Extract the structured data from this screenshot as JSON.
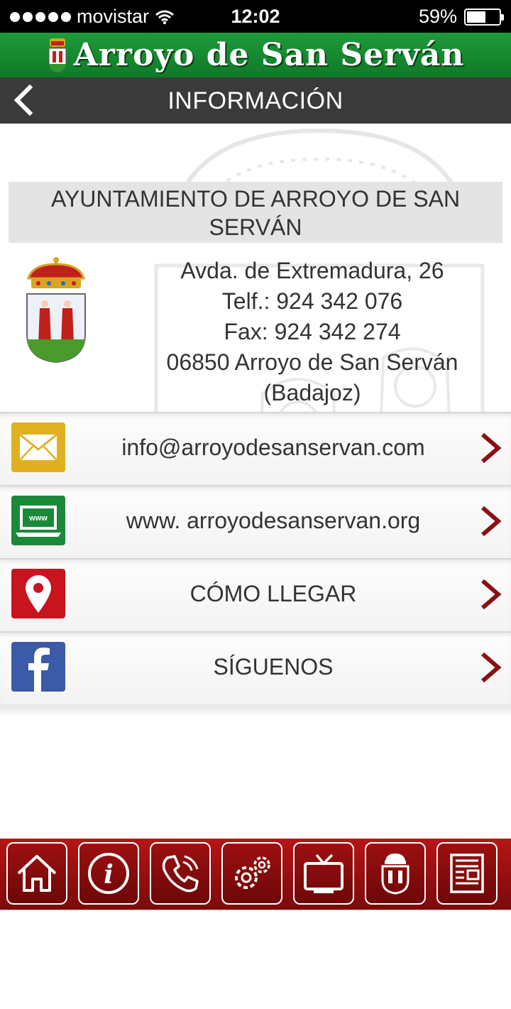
{
  "status_bar": {
    "carrier": "movistar",
    "time": "12:02",
    "battery_text": "59%",
    "battery_level": 0.59
  },
  "brand": {
    "title": "Arroyo de San Serván"
  },
  "navbar": {
    "title": "INFORMACIÓN"
  },
  "info": {
    "heading": "AYUNTAMIENTO DE ARROYO DE SAN SERVÁN",
    "address_lines": [
      "Avda. de Extremadura, 26",
      "Telf.: 924 342 076",
      "Fax: 924 342 274",
      "06850 Arroyo de San Serván",
      "(Badajoz)"
    ]
  },
  "links": [
    {
      "label": "info@arroyodesanservan.com",
      "icon": "mail-icon",
      "color": "#e0b020"
    },
    {
      "label": "www. arroyodesanservan.org",
      "icon": "web-icon",
      "color": "#1a8a3a"
    },
    {
      "label": "CÓMO LLEGAR",
      "icon": "map-pin-icon",
      "color": "#c8141e"
    },
    {
      "label": "SÍGUENOS",
      "icon": "facebook-icon",
      "color": "#3b5ba8"
    }
  ],
  "tabs": [
    {
      "name": "home-icon"
    },
    {
      "name": "info-icon"
    },
    {
      "name": "phone-icon"
    },
    {
      "name": "settings-icon"
    },
    {
      "name": "tv-icon"
    },
    {
      "name": "crest-icon"
    },
    {
      "name": "news-icon"
    }
  ],
  "colors": {
    "brand_green": "#1a8a33",
    "navbar_gray": "#3a3a3a",
    "tabbar_red": "#9c1010",
    "chevron_red": "#8b1014"
  }
}
